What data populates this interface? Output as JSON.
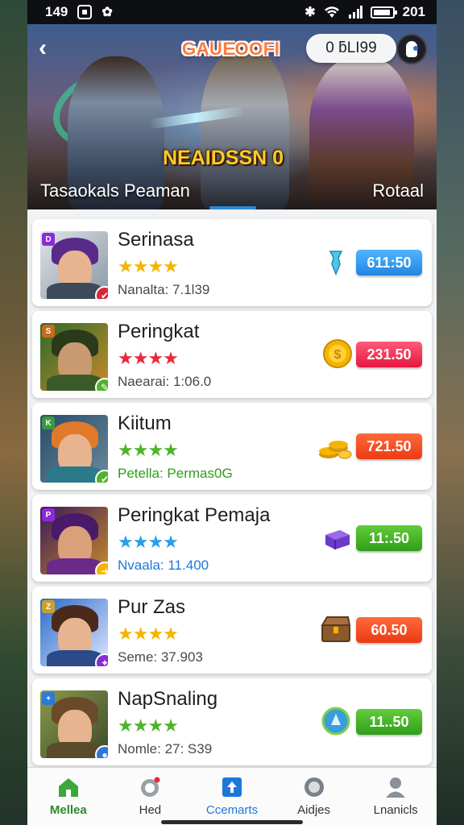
{
  "status_bar": {
    "time": "149",
    "battery_text": "201"
  },
  "header": {
    "title": "GAUEOOFI",
    "balance": "0 ƃLI99",
    "hero_caption": "NEAIDSSN 0",
    "hero_left": "Tasaokals Peaman",
    "hero_right": "Rotaal"
  },
  "items": [
    {
      "name": "Serinasa",
      "sub": "Nanalta: 7.1l39",
      "price": "611:50",
      "tag": "D",
      "star_color": "#f5b400",
      "price_style": "blue",
      "reward": "crystal"
    },
    {
      "name": "Peringkat",
      "sub": "Naearai: 1:06.0",
      "price": "231.50",
      "tag": "S",
      "star_color": "#e8283a",
      "price_style": "red",
      "reward": "coin"
    },
    {
      "name": "Kiitum",
      "sub": "Petella: Permas0G",
      "price": "721.50",
      "tag": "K",
      "star_color": "#4fb32a",
      "price_style": "orange",
      "reward": "coins-stack"
    },
    {
      "name": "Peringkat Pemaja",
      "sub": "Nvaala: 11.400",
      "price": "11:.50",
      "tag": "P",
      "star_color": "#2a9ee8",
      "price_style": "green",
      "reward": "gem-block"
    },
    {
      "name": "Pur Zas",
      "sub": "Seme: 37.903",
      "price": "60.50",
      "tag": "Z",
      "star_color": "#f5b400",
      "price_style": "orange",
      "reward": "chest"
    },
    {
      "name": "NapSnaling",
      "sub": "Nomle: 27: S39",
      "price": "11..50",
      "tag": "+",
      "star_color": "#4fb32a",
      "price_style": "green",
      "reward": "emblem"
    }
  ],
  "stars_text": "★★★★",
  "nav": [
    {
      "label": "Mellea",
      "icon": "home-icon"
    },
    {
      "label": "Hed",
      "icon": "camera-icon"
    },
    {
      "label": "Ccemarts",
      "icon": "upload-icon"
    },
    {
      "label": "Aidjes",
      "icon": "chat-icon"
    },
    {
      "label": "Lnanicls",
      "icon": "profile-icon"
    }
  ]
}
